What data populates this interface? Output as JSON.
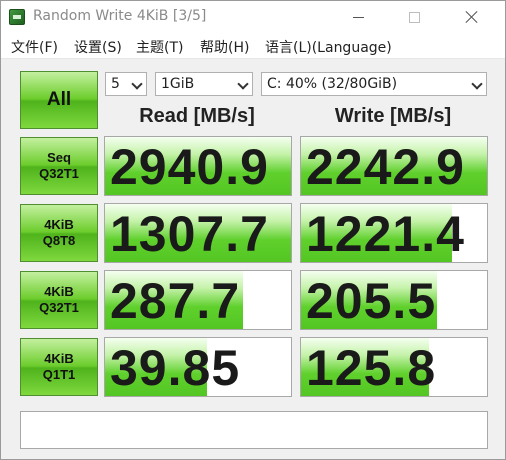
{
  "window": {
    "title": "Random Write 4KiB [3/5]",
    "controls": {
      "minimize": "",
      "maximize": "",
      "close": ""
    }
  },
  "menu": [
    "文件(F)",
    "设置(S)",
    "主题(T)",
    "帮助(H)",
    "语言(L)(Language)"
  ],
  "toolbar": {
    "all_button": "All",
    "count": "5",
    "size": "1GiB",
    "drive": "C: 40% (32/80GiB)"
  },
  "columns": {
    "read": "Read [MB/s]",
    "write": "Write [MB/s]"
  },
  "tests": [
    {
      "line1": "Seq",
      "line2": "Q32T1",
      "read": "2940.9",
      "write": "2242.9",
      "read_level": 1.0,
      "write_level": 1.0
    },
    {
      "line1": "4KiB",
      "line2": "Q8T8",
      "read": "1307.7",
      "write": "1221.4",
      "read_level": 1.0,
      "write_level": 0.81
    },
    {
      "line1": "4KiB",
      "line2": "Q32T1",
      "read": "287.7",
      "write": "205.5",
      "read_level": 0.74,
      "write_level": 0.73
    },
    {
      "line1": "4KiB",
      "line2": "Q1T1",
      "read": "39.85",
      "write": "125.8",
      "read_level": 0.55,
      "write_level": 0.69
    }
  ],
  "comment": "",
  "colors": {
    "accent_green": "#5fd02c",
    "button_green": "#6ccd2c"
  }
}
